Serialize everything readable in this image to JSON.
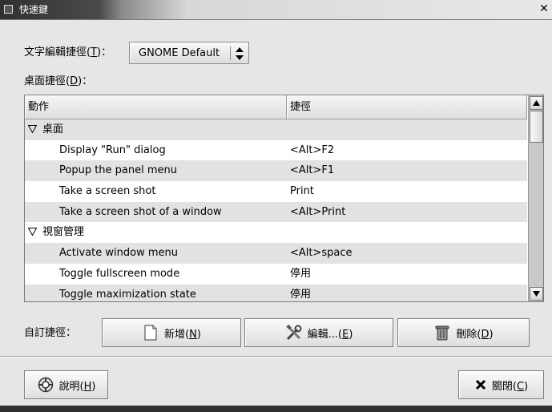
{
  "window": {
    "title": "快速鍵"
  },
  "text_editing": {
    "label": "文字編輯捷徑",
    "mnemonic": "T",
    "label_suffix": "：",
    "selected": "GNOME Default"
  },
  "desktop_shortcuts": {
    "label": "桌面捷徑",
    "mnemonic": "D",
    "label_suffix": "："
  },
  "table": {
    "columns": [
      "動作",
      "捷徑"
    ],
    "rows": [
      {
        "kind": "group",
        "action": "桌面",
        "shortcut": ""
      },
      {
        "kind": "item",
        "action": "Display \"Run\" dialog",
        "shortcut": "<Alt>F2"
      },
      {
        "kind": "item",
        "action": "Popup the panel menu",
        "shortcut": "<Alt>F1"
      },
      {
        "kind": "item",
        "action": "Take a screen shot",
        "shortcut": "Print"
      },
      {
        "kind": "item",
        "action": "Take a screen shot of a window",
        "shortcut": "<Alt>Print"
      },
      {
        "kind": "group",
        "action": "視窗管理",
        "shortcut": ""
      },
      {
        "kind": "item",
        "action": "Activate window menu",
        "shortcut": "<Alt>space"
      },
      {
        "kind": "item",
        "action": "Toggle fullscreen mode",
        "shortcut": "停用"
      },
      {
        "kind": "item",
        "action": "Toggle maximization state",
        "shortcut": "停用"
      }
    ]
  },
  "custom": {
    "label": "自訂捷徑：",
    "add": {
      "label": "新增",
      "mnemonic": "N"
    },
    "edit": {
      "label": "編輯...",
      "mnemonic": "E"
    },
    "remove": {
      "label": "刪除",
      "mnemonic": "D"
    }
  },
  "footer": {
    "help": {
      "label": "說明",
      "mnemonic": "H"
    },
    "close": {
      "label": "關閉",
      "mnemonic": "C"
    }
  },
  "icons": {
    "add": "new-document-icon",
    "edit": "tools-icon",
    "remove": "trash-icon",
    "help": "lifebuoy-icon",
    "close": "close-x-icon"
  }
}
